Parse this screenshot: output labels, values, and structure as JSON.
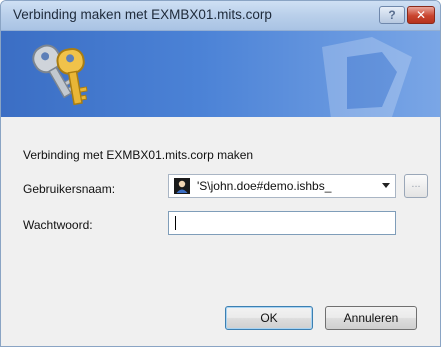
{
  "window": {
    "title": "Verbinding maken met EXMBX01.mits.corp"
  },
  "title_buttons": {
    "help_label": "?",
    "close_label": "✕"
  },
  "banner": {
    "icon": "keys-icon"
  },
  "form": {
    "heading": "Verbinding met EXMBX01.mits.corp maken",
    "username_label": "Gebruikersnaam:",
    "username_value": "'S\\john.doe#demo.ishbs_",
    "username_icon": "user-account-icon",
    "browse_label": "...",
    "password_label": "Wachtwoord:",
    "password_value": ""
  },
  "buttons": {
    "ok_label": "OK",
    "cancel_label": "Annuleren"
  },
  "colors": {
    "banner_blue": "#4b82d6",
    "title_bar": "#b9cfea",
    "close_red": "#c9452e"
  }
}
